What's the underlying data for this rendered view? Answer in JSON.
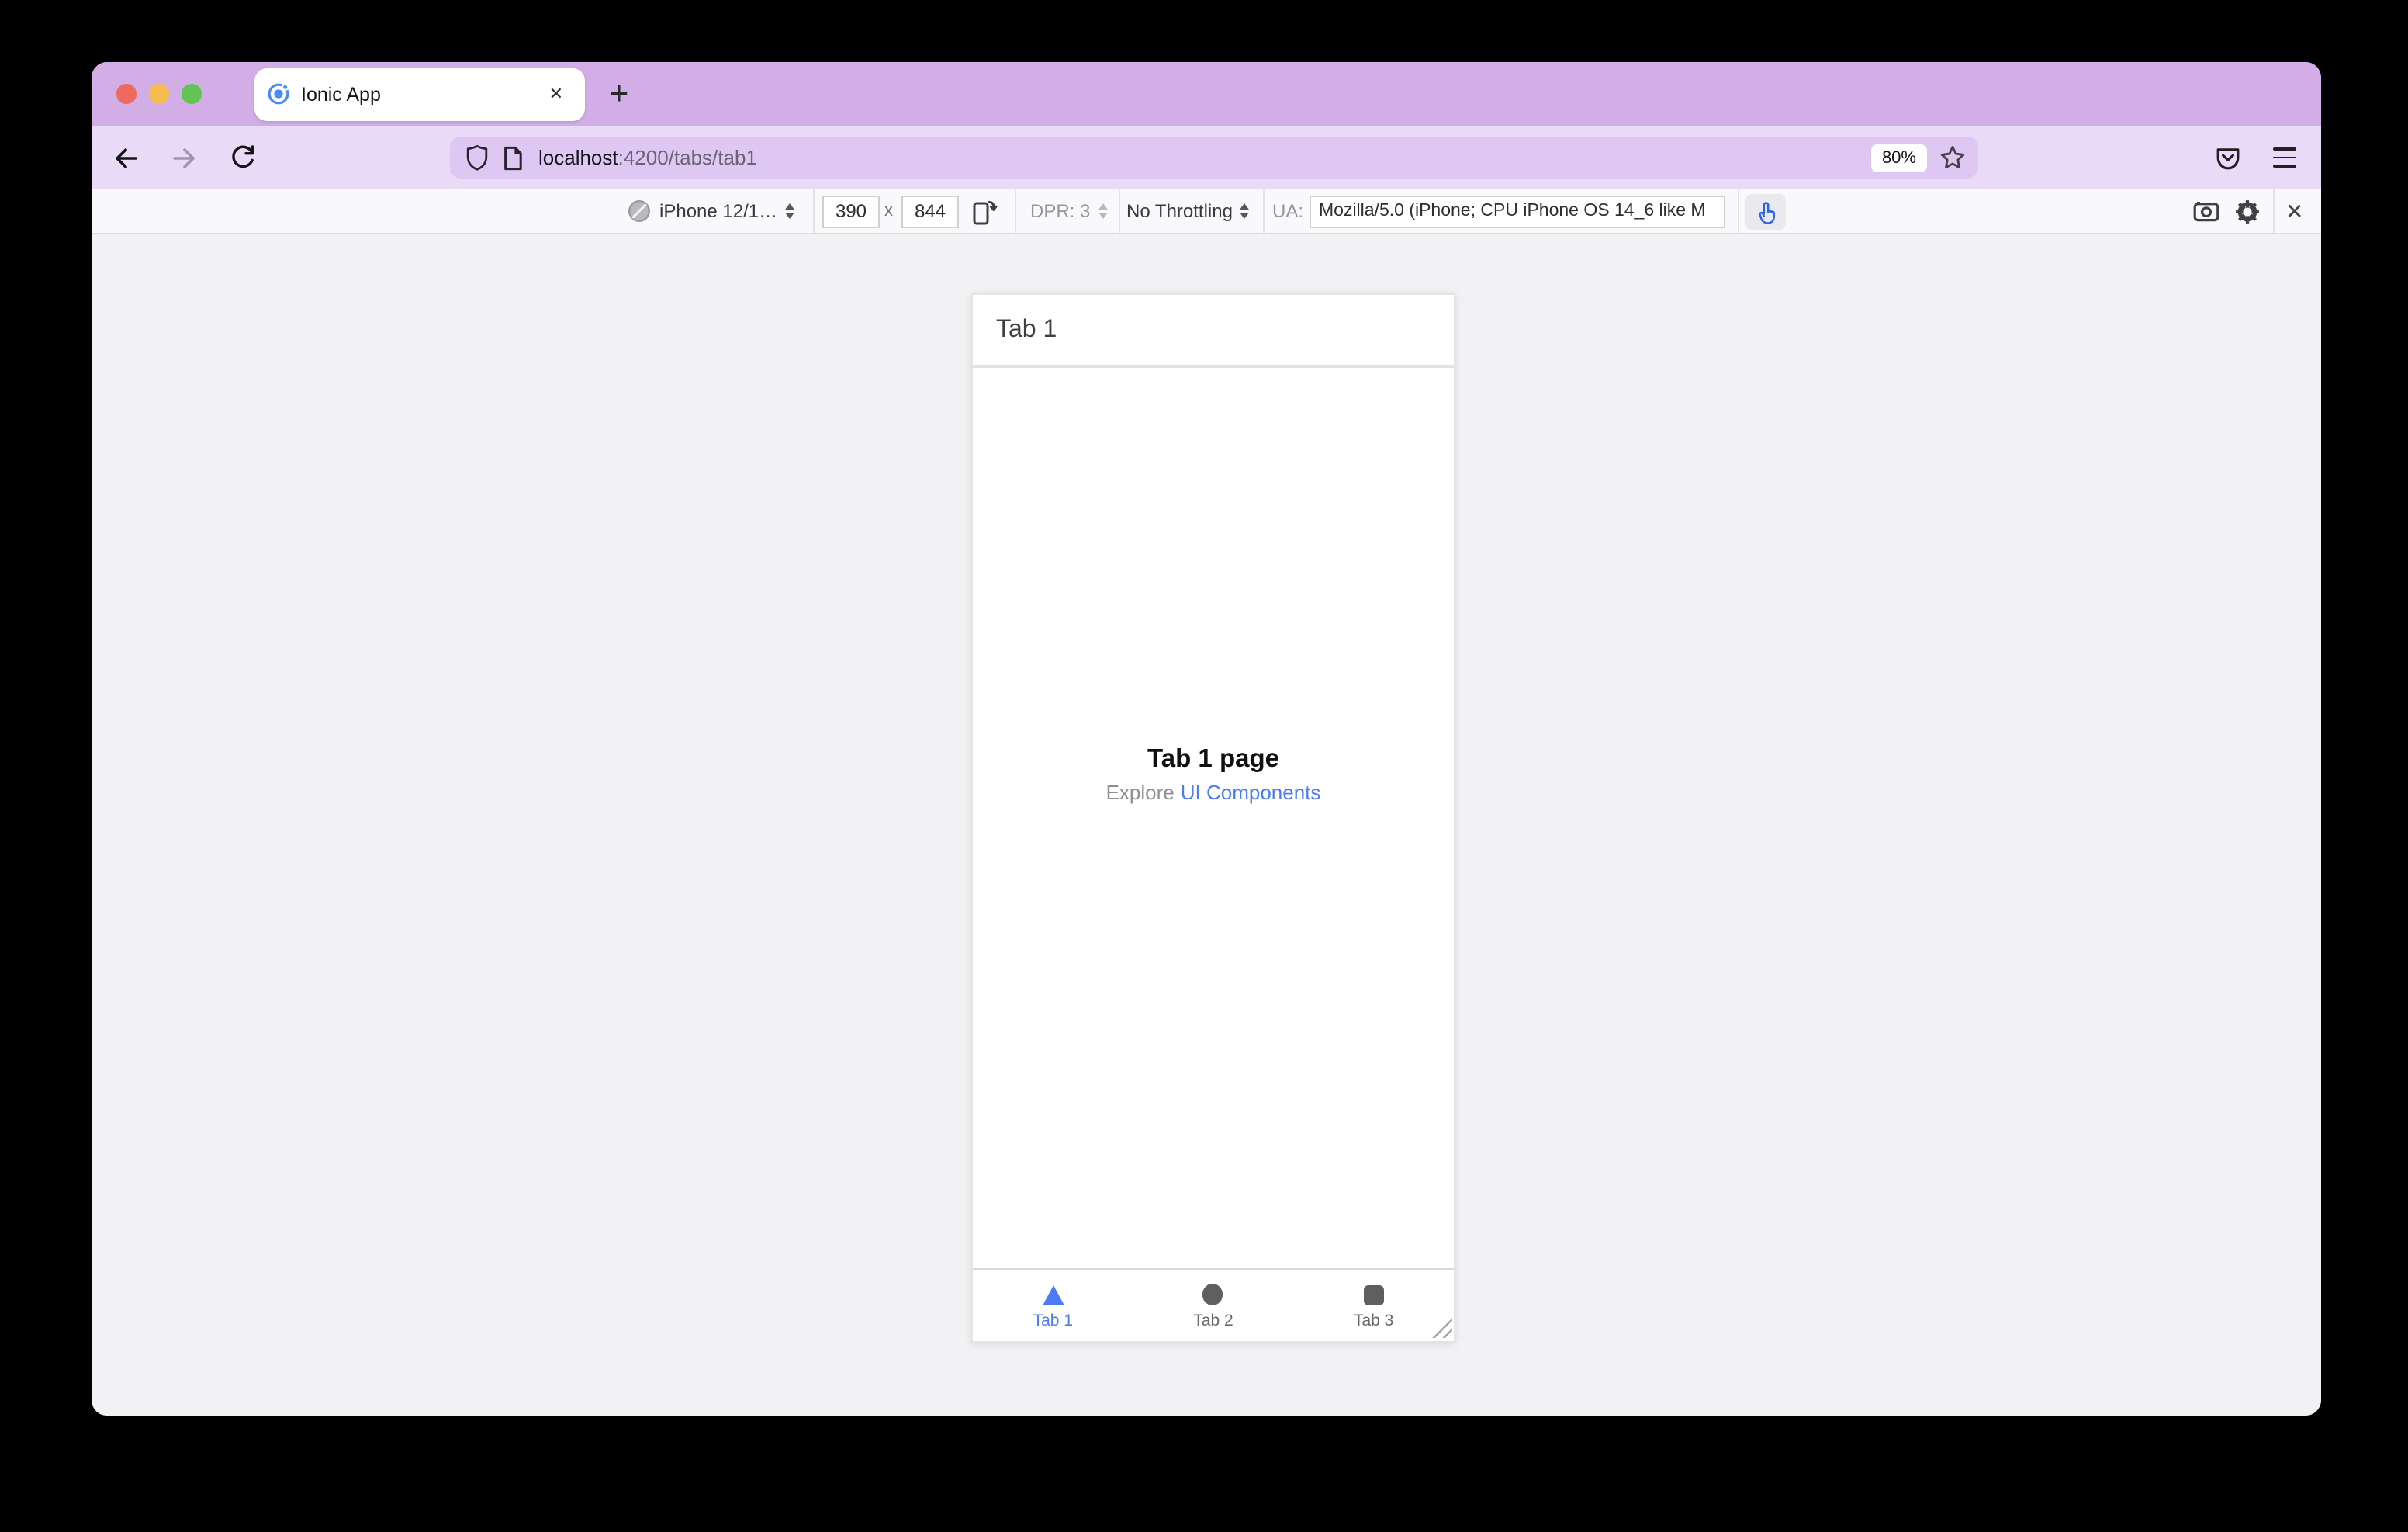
{
  "titlebar": {
    "tab_title": "Ionic App",
    "close_icon": "✕",
    "new_tab_icon": "+"
  },
  "navbar": {
    "url_host": "localhost",
    "url_rest": ":4200/tabs/tab1",
    "zoom_badge": "80%"
  },
  "rdm_toolbar": {
    "device_selector": "iPhone 12/1…",
    "viewport_width": "390",
    "dimension_separator": "x",
    "viewport_height": "844",
    "dpr_label": "DPR: 3",
    "throttling_label": "No Throttling",
    "ua_label": "UA:",
    "ua_value": "Mozilla/5.0 (iPhone; CPU iPhone OS 14_6 like M",
    "close_icon": "✕"
  },
  "phone": {
    "header_title": "Tab 1",
    "content_title": "Tab 1 page",
    "explore_text": "Explore",
    "explore_link": "UI Components",
    "tabs": [
      {
        "label": "Tab 1",
        "icon": "triangle",
        "active": true
      },
      {
        "label": "Tab 2",
        "icon": "ellipse",
        "active": false
      },
      {
        "label": "Tab 3",
        "icon": "square",
        "active": false
      }
    ]
  },
  "colors": {
    "accent_blue": "#4b7bf5",
    "titlebar_purple": "#d3ade6",
    "navbar_purple": "#e9dbf7",
    "url_field_purple": "#dfc7f3",
    "toolbar_bg": "#f9f9fb",
    "content_bg": "#f2f1f3",
    "inactive_tab_gray": "#5f5f5f"
  }
}
